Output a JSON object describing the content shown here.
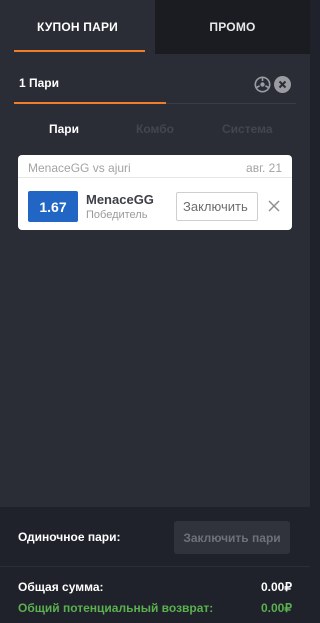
{
  "tabs": {
    "coupon_label": "КУПОН ПАРИ",
    "promo_label": "ПРОМО"
  },
  "coupon": {
    "count_label": "1 Пари",
    "bet_types": [
      "Пари",
      "Комбо",
      "Система"
    ],
    "active_bet_type": "Пари"
  },
  "bet": {
    "event": "MenaceGG vs ajuri",
    "date": "авг. 21",
    "odds": "1.67",
    "selection": "MenaceGG",
    "market": "Победитель",
    "stake_placeholder": "Заключить"
  },
  "footer": {
    "single_label": "Одиночное пари:",
    "place_button": "Заключить пари",
    "total_label": "Общая сумма:",
    "total_value": "0.00₽",
    "return_label": "Общий потенциальный возврат:",
    "return_value": "0.00₽"
  },
  "colors": {
    "accent": "#f07d29",
    "odds_blue": "#2166c5",
    "return_green": "#5bb04f"
  },
  "icons": [
    "settings-icon",
    "clear-icon",
    "remove-icon"
  ]
}
